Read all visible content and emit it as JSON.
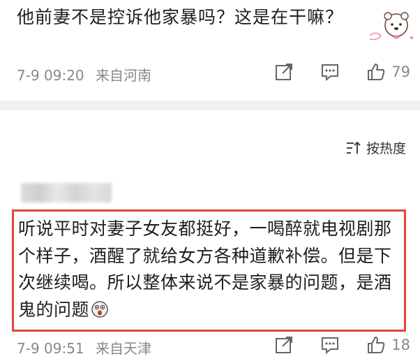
{
  "comments": [
    {
      "text": "他前妻不是控诉他家暴吗？这是在干嘛？",
      "date": "7-9 09:20",
      "region": "来自河南",
      "likes": "79",
      "sticker": "bear-sticker-icon"
    },
    {
      "text": "听说平时对妻子女友都挺好，一喝醉就电视剧那个样子，酒醒了就给女方各种道歉补偿。但是下次继续喝。所以整体来说不是家暴的问题，是酒鬼的问题",
      "emoji": "shocked-face-emoji",
      "date": "7-9 09:51",
      "region": "来自天津",
      "likes": "18",
      "highlighted": true,
      "highlight_color": "#e3463c"
    }
  ],
  "sort": {
    "label": "按热度",
    "icon": "sort-icon"
  },
  "icons": [
    "share-icon",
    "comment-icon",
    "like-icon"
  ]
}
